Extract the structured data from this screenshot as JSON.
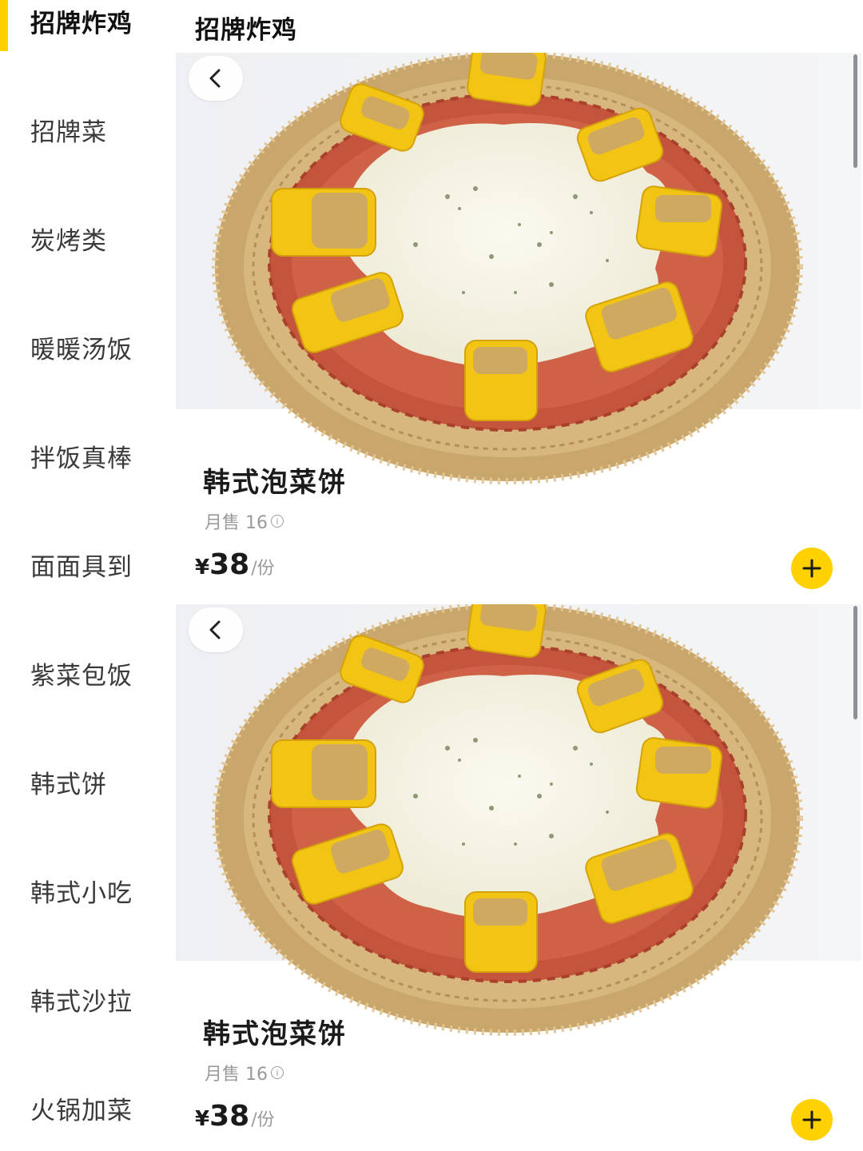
{
  "sidebar": {
    "items": [
      {
        "label": "招牌炸鸡",
        "active": true
      },
      {
        "label": "招牌菜"
      },
      {
        "label": "炭烤类"
      },
      {
        "label": "暖暖汤饭"
      },
      {
        "label": "拌饭真棒"
      },
      {
        "label": "面面具到"
      },
      {
        "label": "紫菜包饭"
      },
      {
        "label": "韩式饼"
      },
      {
        "label": "韩式小吃"
      },
      {
        "label": "韩式沙拉"
      },
      {
        "label": "火锅加菜"
      }
    ]
  },
  "section": {
    "title": "招牌炸鸡"
  },
  "products": [
    {
      "name": "韩式泡菜饼",
      "sales": "月售 16",
      "currency": "¥",
      "price": "38",
      "unit": "/份"
    },
    {
      "name": "韩式泡菜饼",
      "sales": "月售 16",
      "currency": "¥",
      "price": "38",
      "unit": "/份"
    }
  ],
  "colors": {
    "accent": "#ffd100",
    "text": "#1b1b1b",
    "muted": "#9a9a9a"
  },
  "icons": {
    "back": "chevron-left-icon",
    "add": "plus-icon",
    "info": "info-icon"
  }
}
